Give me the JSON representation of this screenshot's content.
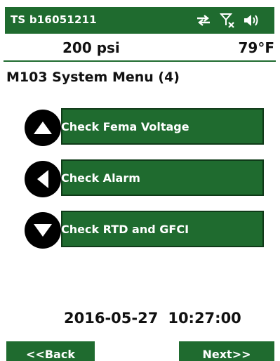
{
  "header": {
    "device_id": "TS b16051211",
    "icons": [
      "sync-arrows-icon",
      "no-signal-icon",
      "speaker-icon"
    ]
  },
  "readings": {
    "pressure": "200 psi",
    "temperature": "79°F"
  },
  "menu": {
    "title": "M103 System Menu (4)",
    "items": [
      {
        "label": "Check Fema Voltage",
        "icon": "up-arrow-icon"
      },
      {
        "label": "Check Alarm",
        "icon": "left-arrow-icon"
      },
      {
        "label": "Check RTD and GFCI",
        "icon": "down-arrow-icon"
      }
    ]
  },
  "footer": {
    "date": "2016-05-27",
    "time": "10:27:00",
    "back_label": "<<Back",
    "next_label": "Next>>"
  },
  "colors": {
    "accent_green": "#1f6b2f",
    "button_border": "#0f3a18",
    "nav_circle": "#000000"
  }
}
